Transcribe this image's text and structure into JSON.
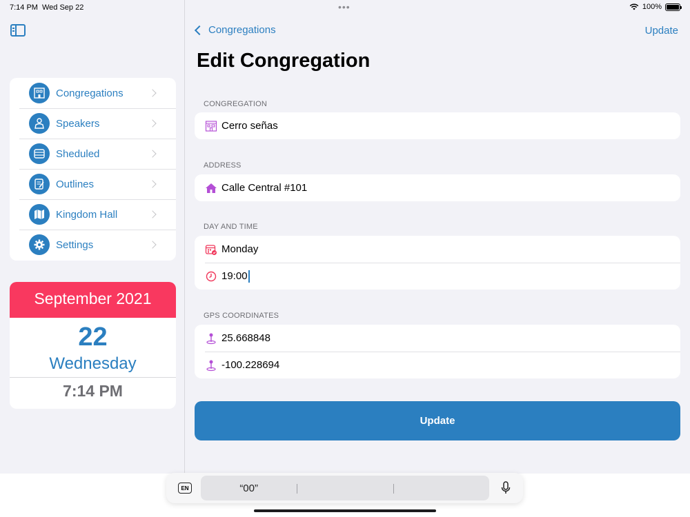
{
  "status": {
    "time": "7:14 PM",
    "date": "Wed Sep 22",
    "dots": "•••",
    "battery": "100%"
  },
  "sidebar": {
    "items": [
      {
        "label": "Congregations",
        "icon": "building-icon"
      },
      {
        "label": "Speakers",
        "icon": "speaker-person-icon"
      },
      {
        "label": "Sheduled",
        "icon": "schedule-icon"
      },
      {
        "label": "Outlines",
        "icon": "outline-document-icon"
      },
      {
        "label": "Kingdom Hall",
        "icon": "map-icon"
      },
      {
        "label": "Settings",
        "icon": "gear-icon"
      }
    ],
    "calendar": {
      "month": "September 2021",
      "day": "22",
      "weekday": "Wednesday",
      "time": "7:14 PM"
    }
  },
  "nav": {
    "back_label": "Congregations",
    "update_label": "Update"
  },
  "main": {
    "title": "Edit Congregation",
    "sections": {
      "congregation": {
        "label": "CONGREGATION",
        "value": "Cerro señas"
      },
      "address": {
        "label": "ADDRESS",
        "value": "Calle Central #101"
      },
      "day_time": {
        "label": "DAY AND TIME",
        "day": "Monday",
        "time": "19:00"
      },
      "gps": {
        "label": "GPS COORDINATES",
        "latitude": "25.668848",
        "longitude": "-100.228694"
      }
    },
    "update_button": "Update"
  },
  "keyboard": {
    "lang": "EN",
    "suggestions": [
      "“00”",
      "",
      ""
    ]
  },
  "colors": {
    "accent": "#2b7fc0",
    "calendar_header": "#f9385f",
    "icon_purple": "#b44fd6",
    "icon_red": "#f0365a"
  }
}
